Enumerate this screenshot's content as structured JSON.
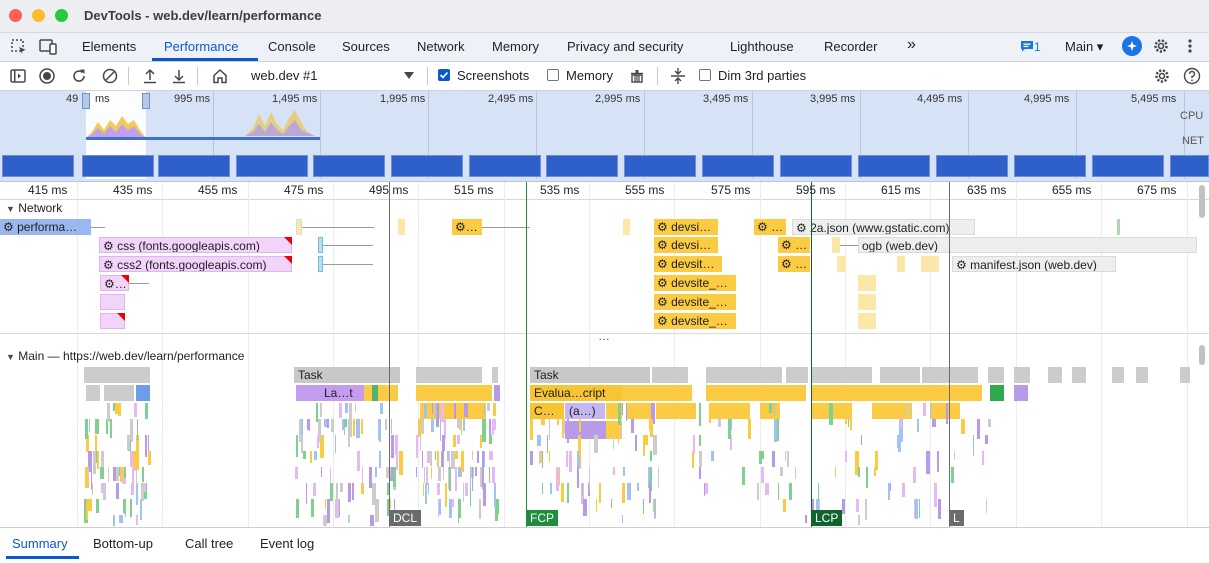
{
  "window": {
    "title": "DevTools - web.dev/learn/performance"
  },
  "tabs": [
    {
      "label": "Elements"
    },
    {
      "label": "Performance"
    },
    {
      "label": "Console"
    },
    {
      "label": "Sources"
    },
    {
      "label": "Network"
    },
    {
      "label": "Memory"
    },
    {
      "label": "Privacy and security"
    },
    {
      "label": "Lighthouse"
    },
    {
      "label": "Recorder"
    }
  ],
  "tabs_right": {
    "overflow": "»",
    "issues_count": "1",
    "target": "Main ▾"
  },
  "toolbar": {
    "recording_select": "web.dev #1",
    "screenshots_label": "Screenshots",
    "screenshots_checked": true,
    "memory_label": "Memory",
    "memory_checked": false,
    "dim_label": "Dim 3rd parties",
    "dim_checked": false
  },
  "overview": {
    "ticks": [
      "49",
      "ms",
      "995 ms",
      "1,495 ms",
      "1,995 ms",
      "2,495 ms",
      "2,995 ms",
      "3,495 ms",
      "3,995 ms",
      "4,495 ms",
      "4,995 ms",
      "5,495 ms"
    ],
    "cpu_label": "CPU",
    "net_label": "NET"
  },
  "ruler": {
    "ticks": [
      "415 ms",
      "435 ms",
      "455 ms",
      "475 ms",
      "495 ms",
      "515 ms",
      "535 ms",
      "555 ms",
      "575 ms",
      "595 ms",
      "615 ms",
      "635 ms",
      "655 ms",
      "675 ms"
    ]
  },
  "network": {
    "header": "Network",
    "requests": [
      {
        "label": "performa…"
      },
      {
        "label": "css (fonts.googleapis.com)"
      },
      {
        "label": "css2 (fonts.googleapis.com)"
      },
      {
        "label": "…"
      },
      {
        "label": "devsi…"
      },
      {
        "label": "devsi…"
      },
      {
        "label": "devsit…"
      },
      {
        "label": "devsite_…"
      },
      {
        "label": "devsite_…"
      },
      {
        "label": "devsite_…"
      },
      {
        "label": "…"
      },
      {
        "label": "…"
      },
      {
        "label": "…"
      },
      {
        "label": "2a.json (www.gstatic.com)"
      },
      {
        "label": "ogb (web.dev)"
      },
      {
        "label": "manifest.json (web.dev)"
      }
    ],
    "ellipsis": "…"
  },
  "main": {
    "header": "Main — https://web.dev/learn/performance",
    "flames": [
      {
        "label": "Task"
      },
      {
        "label": "La…t"
      },
      {
        "label": "Task"
      },
      {
        "label": "Evalua…cript"
      },
      {
        "label": "C…"
      },
      {
        "label": "(a…)"
      }
    ]
  },
  "markers": [
    {
      "label": "DCL",
      "color": "#6b6b6b"
    },
    {
      "label": "FCP",
      "color": "#1e8e3e"
    },
    {
      "label": "LCP",
      "color": "#0d652d"
    },
    {
      "label": "L",
      "color": "#6b6b6b"
    }
  ],
  "bottom_tabs": [
    {
      "label": "Summary"
    },
    {
      "label": "Bottom-up"
    },
    {
      "label": "Call tree"
    },
    {
      "label": "Event log"
    }
  ],
  "colors": {
    "accent": "#0b57d0",
    "script": "#fbcb43",
    "stylesheet": "#f2d4fa",
    "task": "#cccccc",
    "rendering": "#b89be8"
  }
}
